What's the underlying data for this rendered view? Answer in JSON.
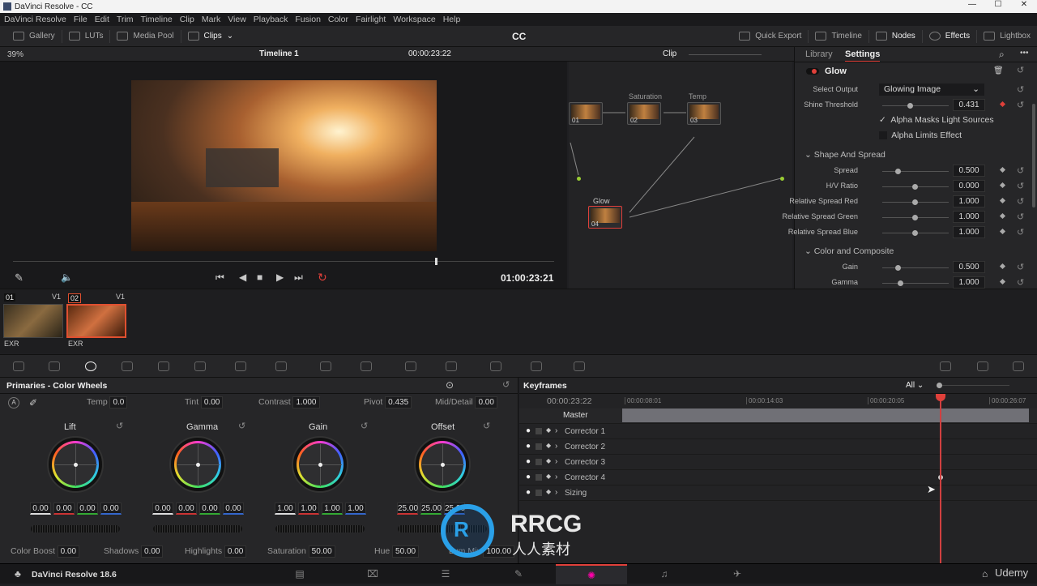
{
  "window": {
    "title": "DaVinci Resolve - CC",
    "min": "—",
    "max": "☐",
    "close": "✕"
  },
  "menu": [
    "DaVinci Resolve",
    "File",
    "Edit",
    "Trim",
    "Timeline",
    "Clip",
    "Mark",
    "View",
    "Playback",
    "Fusion",
    "Color",
    "Fairlight",
    "Workspace",
    "Help"
  ],
  "toolbar": {
    "left": [
      "Gallery",
      "LUTs",
      "Media Pool",
      "Clips"
    ],
    "project": "CC",
    "right": [
      "Quick Export",
      "Timeline",
      "Nodes",
      "Effects",
      "Lightbox"
    ]
  },
  "viewer": {
    "zoom": "39%",
    "timeline": "Timeline 1",
    "timecode": "00:00:23:22",
    "playhead_tc": "01:00:23:21",
    "scrub_progress": 0.78
  },
  "node_editor": {
    "mode": "Clip",
    "nodes": [
      {
        "num": "01",
        "label": ""
      },
      {
        "num": "02",
        "label": "Saturation"
      },
      {
        "num": "03",
        "label": "Temp"
      },
      {
        "num": "04",
        "label": "Glow"
      }
    ]
  },
  "settings": {
    "tabs": [
      "Library",
      "Settings"
    ],
    "active_tab": "Settings",
    "effect": "Glow",
    "select_output_label": "Select Output",
    "select_output": "Glowing Image",
    "shine": {
      "label": "Shine Threshold",
      "value": "0.431"
    },
    "checks": [
      {
        "label": "Alpha Masks Light Sources",
        "checked": true
      },
      {
        "label": "Alpha Limits Effect",
        "checked": false
      }
    ],
    "sections": [
      "Shape And Spread",
      "Color and Composite"
    ],
    "shape": [
      {
        "label": "Spread",
        "value": "0.500"
      },
      {
        "label": "H/V Ratio",
        "value": "0.000"
      },
      {
        "label": "Relative Spread Red",
        "value": "1.000"
      },
      {
        "label": "Relative Spread Green",
        "value": "1.000"
      },
      {
        "label": "Relative Spread Blue",
        "value": "1.000"
      }
    ],
    "color": [
      {
        "label": "Gain",
        "value": "0.500"
      },
      {
        "label": "Gamma",
        "value": "1.000"
      }
    ]
  },
  "clips": [
    {
      "num": "01",
      "track": "V1",
      "codec": "EXR"
    },
    {
      "num": "02",
      "track": "V1",
      "codec": "EXR"
    }
  ],
  "primaries": {
    "title": "Primaries - Color Wheels",
    "top": [
      {
        "label": "Temp",
        "value": "0.0"
      },
      {
        "label": "Tint",
        "value": "0.00"
      },
      {
        "label": "Contrast",
        "value": "1.000"
      },
      {
        "label": "Pivot",
        "value": "0.435"
      },
      {
        "label": "Mid/Detail",
        "value": "0.00"
      }
    ],
    "wheels": [
      {
        "name": "Lift",
        "values": [
          "0.00",
          "0.00",
          "0.00",
          "0.00"
        ]
      },
      {
        "name": "Gamma",
        "values": [
          "0.00",
          "0.00",
          "0.00",
          "0.00"
        ]
      },
      {
        "name": "Gain",
        "values": [
          "1.00",
          "1.00",
          "1.00",
          "1.00"
        ]
      },
      {
        "name": "Offset",
        "values": [
          "25.00",
          "25.00",
          "25.00"
        ]
      }
    ],
    "bottom": [
      {
        "label": "Color Boost",
        "value": "0.00"
      },
      {
        "label": "Shadows",
        "value": "0.00"
      },
      {
        "label": "Highlights",
        "value": "0.00"
      },
      {
        "label": "Saturation",
        "value": "50.00"
      },
      {
        "label": "Hue",
        "value": "50.00"
      },
      {
        "label": "Lum Mix",
        "value": "100.00"
      }
    ]
  },
  "keyframes": {
    "title": "Keyframes",
    "filter": "All",
    "timecode": "00:00:23:22",
    "ruler": [
      "00:00:08:01",
      "00:00:14:03",
      "00:00:20:05",
      "00:00:26:07"
    ],
    "master": "Master",
    "tracks": [
      "Corrector 1",
      "Corrector 2",
      "Corrector 3",
      "Corrector 4",
      "Sizing"
    ]
  },
  "bottombar": {
    "app": "DaVinci Resolve 18.6",
    "active_page": "color"
  },
  "watermark": {
    "logo": "RRCG",
    "sub": "人人素材",
    "udemy": "Udemy"
  },
  "colors": {
    "accent": "#e0403a",
    "bg": "#262628"
  }
}
